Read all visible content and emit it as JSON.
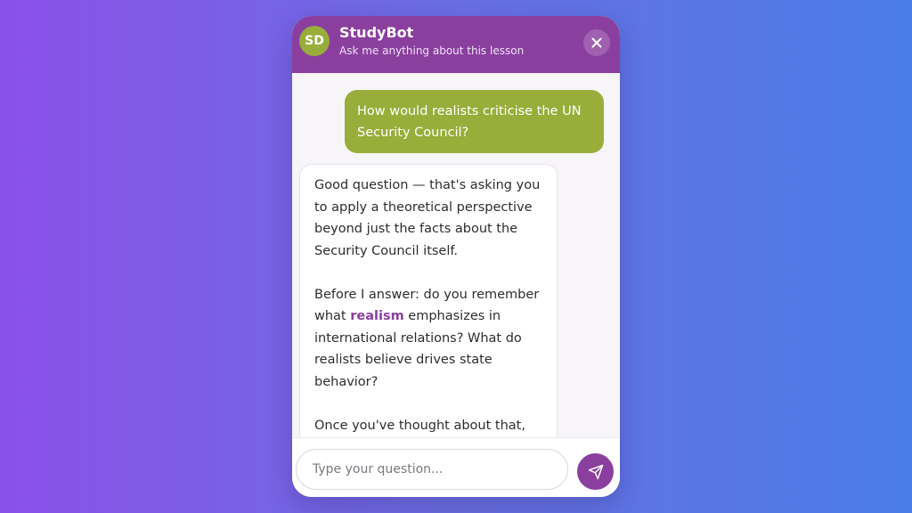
{
  "header": {
    "avatar_initials": "SD",
    "title": "StudyBot",
    "subtitle": "Ask me anything about this lesson",
    "close_icon": "close-icon"
  },
  "conversation": {
    "user_message": "How would realists criticise the UN Security Council?",
    "bot_message": {
      "p1": "Good question — that's asking you to apply a theoretical perspective beyond just the facts about the Security Council itself.",
      "p2_before": "Before I answer: do you remember what ",
      "p2_highlight": "realism",
      "p2_after": " emphasizes in international relations? What do realists believe drives state behavior?",
      "p3": "Once you've thought about that,"
    }
  },
  "composer": {
    "placeholder": "Type your question...",
    "send_icon": "send-icon"
  },
  "colors": {
    "header_purple": "#8a3f9f",
    "user_bubble_olive": "#98ad3a",
    "highlight_purple": "#8a3f9f"
  }
}
